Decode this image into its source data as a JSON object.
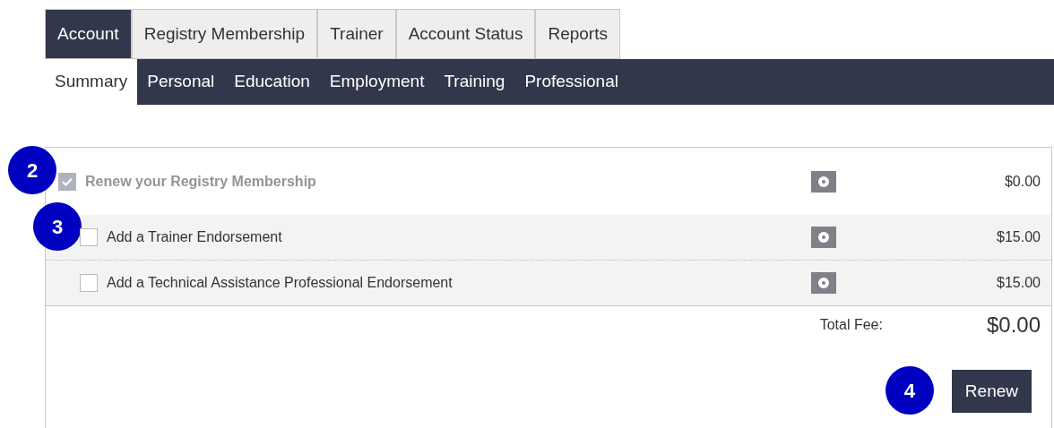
{
  "tabs": [
    {
      "label": "Account",
      "selected": true
    },
    {
      "label": "Registry Membership",
      "selected": false
    },
    {
      "label": "Trainer",
      "selected": false
    },
    {
      "label": "Account Status",
      "selected": false
    },
    {
      "label": "Reports",
      "selected": false
    }
  ],
  "subtabs": [
    {
      "label": "Summary",
      "selected": true
    },
    {
      "label": "Personal",
      "selected": false
    },
    {
      "label": "Education",
      "selected": false
    },
    {
      "label": "Employment",
      "selected": false
    },
    {
      "label": "Training",
      "selected": false
    },
    {
      "label": "Professional",
      "selected": false
    }
  ],
  "options": [
    {
      "label": "Renew your Registry Membership",
      "price": "$0.00",
      "checked": true,
      "disabled": true,
      "indented": false,
      "badge": "2"
    },
    {
      "label": "Add a Trainer Endorsement",
      "price": "$15.00",
      "checked": false,
      "disabled": false,
      "indented": true,
      "badge": "3"
    },
    {
      "label": "Add a Technical Assistance Professional Endorsement",
      "price": "$15.00",
      "checked": false,
      "disabled": false,
      "indented": true
    }
  ],
  "total": {
    "label": "Total Fee:",
    "value": "$0.00"
  },
  "renew_button": {
    "label": "Renew",
    "badge": "4"
  }
}
